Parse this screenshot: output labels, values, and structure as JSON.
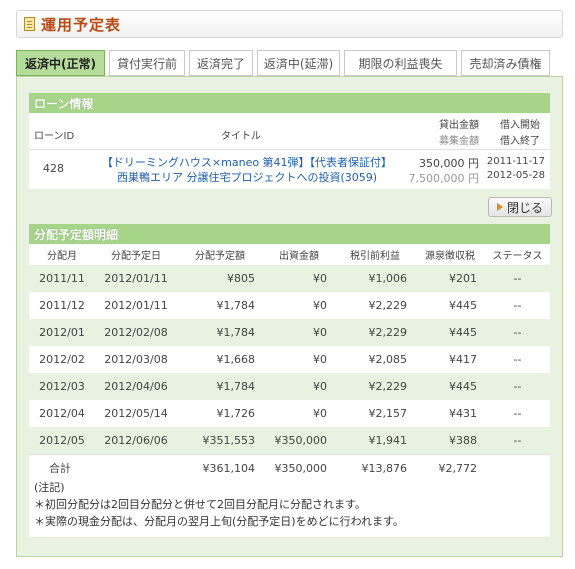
{
  "header": {
    "title": "運用予定表",
    "icon": "document-icon"
  },
  "tabs": [
    {
      "label": "返済中(正常)",
      "active": true
    },
    {
      "label": "貸付実行前"
    },
    {
      "label": "返済完了"
    },
    {
      "label": "返済中(延滞)"
    },
    {
      "label": "期限の利益喪失"
    },
    {
      "label": "売却済み債権"
    }
  ],
  "loan": {
    "section_title": "ローン情報",
    "columns": {
      "id": "ローンID",
      "title": "タイトル",
      "amount": "貸出金額",
      "raise": "募集金額",
      "start": "借入開始",
      "end": "借入終了"
    },
    "row": {
      "id": "428",
      "title_line1": "【ドリーミングハウス×maneo 第41弾】【代表者保証付】",
      "title_line2": "西巣鴨エリア 分譲住宅プロジェクトへの投資(3059)",
      "amount": "350,000 円",
      "raise": "7,500,000 円",
      "start": "2011-11-17",
      "end": "2012-05-28"
    }
  },
  "close_button": {
    "label": "閉じる"
  },
  "schedule": {
    "section_title": "分配予定額明細",
    "columns": [
      "分配月",
      "分配予定日",
      "分配予定額",
      "出資金額",
      "税引前利益",
      "源泉徴収税",
      "ステータス"
    ],
    "rows": [
      [
        "2011/11",
        "2012/01/11",
        "¥805",
        "¥0",
        "¥1,006",
        "¥201",
        "--"
      ],
      [
        "2011/12",
        "2012/01/11",
        "¥1,784",
        "¥0",
        "¥2,229",
        "¥445",
        "--"
      ],
      [
        "2012/01",
        "2012/02/08",
        "¥1,784",
        "¥0",
        "¥2,229",
        "¥445",
        "--"
      ],
      [
        "2012/02",
        "2012/03/08",
        "¥1,668",
        "¥0",
        "¥2,085",
        "¥417",
        "--"
      ],
      [
        "2012/03",
        "2012/04/06",
        "¥1,784",
        "¥0",
        "¥2,229",
        "¥445",
        "--"
      ],
      [
        "2012/04",
        "2012/05/14",
        "¥1,726",
        "¥0",
        "¥2,157",
        "¥431",
        "--"
      ],
      [
        "2012/05",
        "2012/06/06",
        "¥351,553",
        "¥350,000",
        "¥1,941",
        "¥388",
        "--"
      ]
    ],
    "total": {
      "label": "合計",
      "amount": "¥361,104",
      "investment": "¥350,000",
      "pretax": "¥13,876",
      "withholding": "¥2,772"
    }
  },
  "notes": {
    "heading": "(注記)",
    "lines": [
      "＊初回分配分は2回目分配分と併せて2回目分配月に分配されます。",
      "＊実際の現金分配は、分配月の翌月上旬(分配予定日)をめどに行われます。"
    ]
  }
}
